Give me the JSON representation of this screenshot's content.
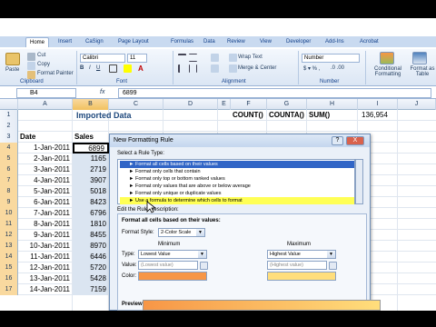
{
  "ribbon": {
    "tabs": [
      "Home",
      "Insert",
      "CaSign",
      "Page Layout",
      "Formulas",
      "Data",
      "Review",
      "View",
      "Developer",
      "Add-Ins",
      "Acrobat"
    ],
    "clipboard": {
      "cut": "Cut",
      "copy": "Copy",
      "format_painter": "Format Painter",
      "paste": "Paste",
      "label": "Clipboard"
    },
    "font": {
      "name": "Calibri",
      "size": "11",
      "label": "Font"
    },
    "alignment": {
      "wrap": "Wrap Text",
      "merge": "Merge & Center",
      "label": "Alignment"
    },
    "number": {
      "format": "Number",
      "label": "Number"
    },
    "styles": {
      "conditional": "Conditional Formatting",
      "format_table": "Format as Table"
    }
  },
  "formula_bar": {
    "name_box": "B4",
    "fx": "fx",
    "value": "6899"
  },
  "grid": {
    "columns": [
      "A",
      "B",
      "C",
      "D",
      "E",
      "F",
      "G",
      "H",
      "I",
      "J"
    ],
    "row_numbers": [
      "1",
      "2",
      "3",
      "4",
      "5",
      "6",
      "7",
      "8",
      "9",
      "10",
      "11",
      "12",
      "13",
      "14",
      "15",
      "16",
      "17"
    ],
    "title": "Imported Data",
    "header_date": "Date",
    "header_sales": "Sales",
    "count_labels": [
      "COUNT()",
      "COUNTA()",
      "SUM()"
    ],
    "total": "136,954",
    "dates": [
      "1-Jan-2011",
      "2-Jan-2011",
      "3-Jan-2011",
      "4-Jan-2011",
      "5-Jan-2011",
      "6-Jan-2011",
      "7-Jan-2011",
      "8-Jan-2011",
      "9-Jan-2011",
      "10-Jan-2011",
      "11-Jan-2011",
      "12-Jan-2011",
      "13-Jan-2011",
      "14-Jan-2011"
    ],
    "sales": [
      "6899",
      "1165",
      "2719",
      "3907",
      "5018",
      "8423",
      "6796",
      "1810",
      "8455",
      "8970",
      "6446",
      "5720",
      "5428",
      "7159"
    ]
  },
  "dialog": {
    "title": "New Formatting Rule",
    "help": "?",
    "close": "X",
    "select_label": "Select a Rule Type:",
    "rule_types": [
      "► Format all cells based on their values",
      "► Format only cells that contain",
      "► Format only top or bottom ranked values",
      "► Format only values that are above or below average",
      "► Format only unique or duplicate values",
      "► Use a formula to determine which cells to format"
    ],
    "edit_label": "Edit the Rule Description:",
    "format_all_label": "Format all cells based on their values:",
    "format_style_label": "Format Style:",
    "format_style_value": "2-Color Scale",
    "minimum_label": "Minimum",
    "maximum_label": "Maximum",
    "type_label": "Type:",
    "value_label": "Value:",
    "color_label": "Color:",
    "min_type": "Lowest Value",
    "max_type": "Highest Value",
    "min_value": "(Lowest value)",
    "max_value": "(Highest value)",
    "preview_label": "Preview:",
    "min_color": "#f79646",
    "max_color": "#ffde7c"
  }
}
